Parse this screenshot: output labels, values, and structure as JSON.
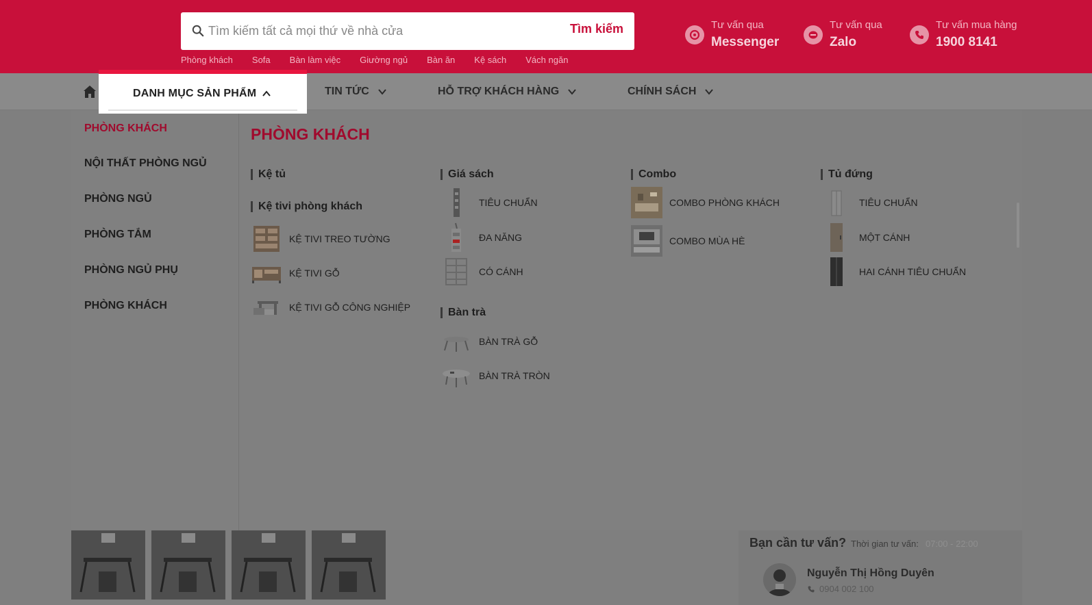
{
  "header": {
    "search": {
      "placeholder": "Tìm kiếm tất cả mọi thứ về nhà cửa",
      "button_label": "Tìm kiếm"
    },
    "quick_links": [
      "Phòng khách",
      "Sofa",
      "Bàn làm việc",
      "Giường ngủ",
      "Bàn ăn",
      "Kệ sách",
      "Vách ngăn"
    ],
    "contacts": [
      {
        "small": "Tư vấn qua",
        "big": "Messenger",
        "icon": "messenger-icon"
      },
      {
        "small": "Tư vấn qua",
        "big": "Zalo",
        "icon": "zalo-icon"
      },
      {
        "small": "Tư vấn mua hàng",
        "big": "1900 8141",
        "icon": "phone-icon"
      }
    ]
  },
  "nav": {
    "home_icon": "home-icon",
    "active_label": "DANH MỤC SẢN PHẨM",
    "items": [
      "TIN TỨC",
      "HỖ TRỢ KHÁCH HÀNG",
      "CHÍNH SÁCH"
    ]
  },
  "mega": {
    "side_items": [
      "PHÒNG KHÁCH",
      "NỘI THẤT PHÒNG NGỦ",
      "PHÒNG NGỦ",
      "PHÒNG TẮM",
      "PHÒNG NGỦ PHỤ",
      "PHÒNG KHÁCH"
    ],
    "title": "PHÒNG KHÁCH",
    "columns": {
      "col1": {
        "group1": "Kệ tủ",
        "group2": "Kệ tivi phòng khách",
        "items": [
          "KỆ TIVI TREO TƯỜNG",
          "KỆ TIVI GỖ",
          "KỆ TIVI GỖ CÔNG NGHIỆP"
        ]
      },
      "col2": {
        "group1": "Giá sách",
        "items1": [
          "TIÊU CHUẨN",
          "ĐA NĂNG",
          "CÓ CÁNH"
        ],
        "group2": "Bàn trà",
        "items2": [
          "BÀN TRÀ GỖ",
          "BÀN TRÀ TRÒN"
        ]
      },
      "col3": {
        "group1": "Combo",
        "items": [
          "COMBO PHÒNG KHÁCH",
          "COMBO MÙA HÈ"
        ]
      },
      "col4": {
        "group1": "Tủ đứng",
        "items": [
          "TIÊU CHUẨN",
          "MỘT CÁNH",
          "HAI CÁNH TIÊU CHUẨN"
        ]
      }
    }
  },
  "consult": {
    "title": "Bạn cần tư vấn?",
    "time_label": "Thời gian tư vấn:",
    "time": "07:00 - 22:00",
    "name": "Nguyễn Thị Hồng Duyên",
    "phone": "0904 002 100"
  },
  "colors": {
    "brand": "#c8103a",
    "accent_active": "#e8163f",
    "overlay": "#808080"
  }
}
